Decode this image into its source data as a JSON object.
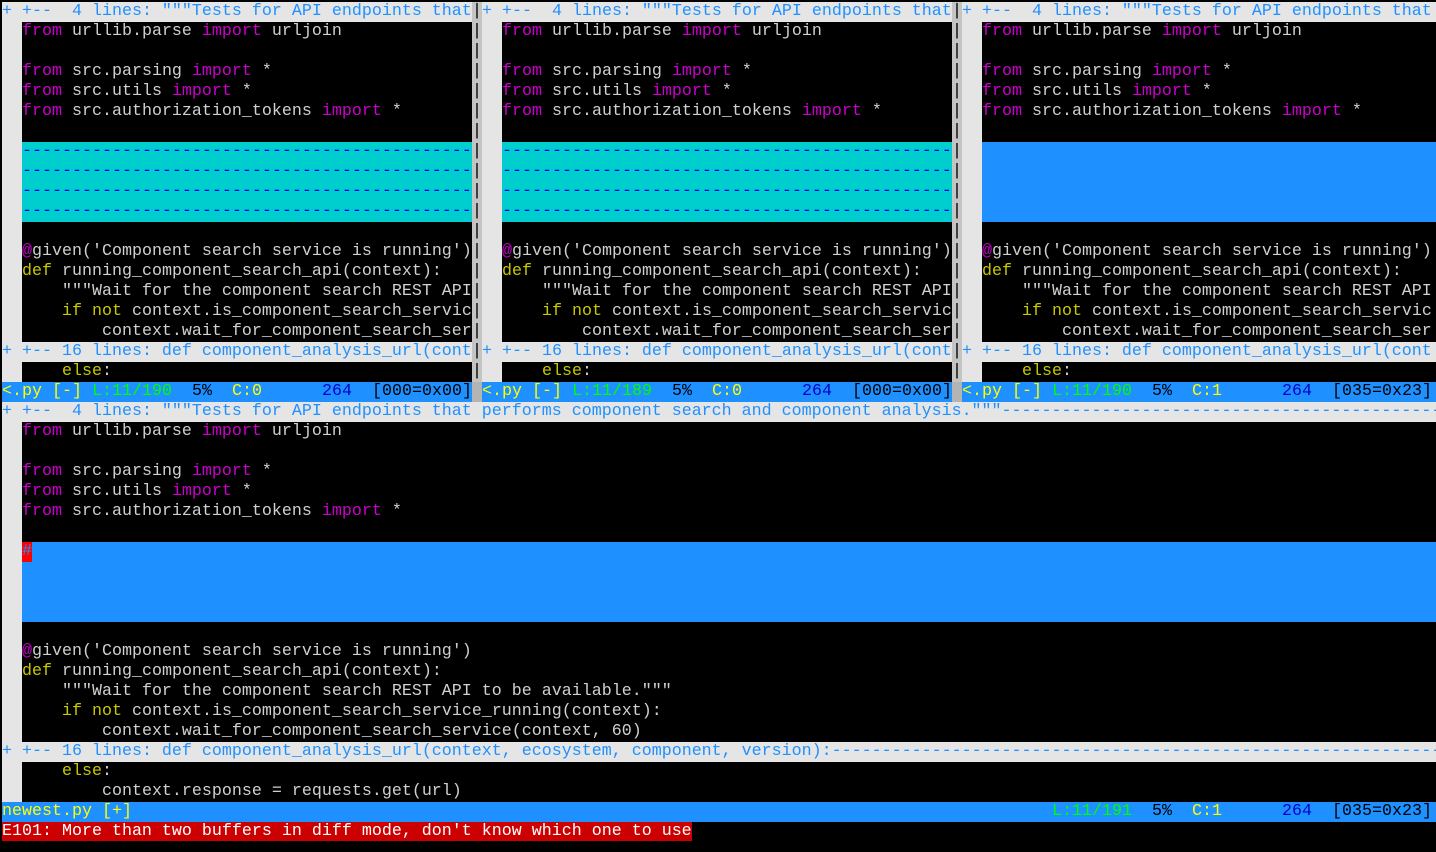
{
  "separator_char": "|",
  "top_lines": [
    {
      "type": "fold",
      "sign": "+",
      "text": "+--  4 lines: \"\"\"Tests for API endpoints that"
    },
    {
      "type": "code",
      "seg": [
        [
          "from",
          "kw"
        ],
        [
          " urllib.parse ",
          "n"
        ],
        [
          "import",
          "kw"
        ],
        [
          " urljoin",
          "n"
        ]
      ]
    },
    {
      "type": "code",
      "seg": []
    },
    {
      "type": "code",
      "seg": [
        [
          "from",
          "kw"
        ],
        [
          " src.parsing ",
          "n"
        ],
        [
          "import",
          "kw"
        ],
        [
          " *",
          "n"
        ]
      ]
    },
    {
      "type": "code",
      "seg": [
        [
          "from",
          "kw"
        ],
        [
          " src.utils ",
          "n"
        ],
        [
          "import",
          "kw"
        ],
        [
          " *",
          "n"
        ]
      ]
    },
    {
      "type": "code",
      "seg": [
        [
          "from",
          "kw"
        ],
        [
          " src.authorization_tokens ",
          "n"
        ],
        [
          "import",
          "kw"
        ],
        [
          " *",
          "n"
        ]
      ]
    },
    {
      "type": "code",
      "seg": []
    },
    {
      "type": "filler"
    },
    {
      "type": "filler"
    },
    {
      "type": "filler"
    },
    {
      "type": "filler"
    },
    {
      "type": "code",
      "seg": []
    },
    {
      "type": "code",
      "seg": [
        [
          "@",
          "at"
        ],
        [
          "given('Component search service is running')",
          "n"
        ]
      ]
    },
    {
      "type": "code",
      "seg": [
        [
          "def",
          "st"
        ],
        [
          " running_component_search_api(context):",
          "n"
        ]
      ]
    },
    {
      "type": "code",
      "seg": [
        [
          "    \"\"\"Wait for the component search REST API",
          "n"
        ]
      ]
    },
    {
      "type": "code",
      "seg": [
        [
          "    ",
          "n"
        ],
        [
          "if",
          "st"
        ],
        [
          " ",
          "n"
        ],
        [
          "not",
          "st"
        ],
        [
          " context.is_component_search_servic",
          "n"
        ]
      ]
    },
    {
      "type": "code",
      "seg": [
        [
          "        context.wait_for_component_search_ser",
          "n"
        ]
      ]
    },
    {
      "type": "fold",
      "sign": "+",
      "text": "+-- 16 lines: def component_analysis_url(cont"
    },
    {
      "type": "code",
      "seg": [
        [
          "    ",
          "n"
        ],
        [
          "else",
          "st"
        ],
        [
          ":",
          "n"
        ]
      ]
    }
  ],
  "bottom_lines": [
    {
      "type": "fold",
      "sign": "+",
      "text": "+--  4 lines: \"\"\"Tests for API endpoints that performs component search and component analysis.\"\"\""
    },
    {
      "type": "code",
      "seg": [
        [
          "from",
          "kw"
        ],
        [
          " urllib.parse ",
          "n"
        ],
        [
          "import",
          "kw"
        ],
        [
          " urljoin",
          "n"
        ]
      ]
    },
    {
      "type": "code",
      "seg": []
    },
    {
      "type": "code",
      "seg": [
        [
          "from",
          "kw"
        ],
        [
          " src.parsing ",
          "n"
        ],
        [
          "import",
          "kw"
        ],
        [
          " *",
          "n"
        ]
      ]
    },
    {
      "type": "code",
      "seg": [
        [
          "from",
          "kw"
        ],
        [
          " src.utils ",
          "n"
        ],
        [
          "import",
          "kw"
        ],
        [
          " *",
          "n"
        ]
      ]
    },
    {
      "type": "code",
      "seg": [
        [
          "from",
          "kw"
        ],
        [
          " src.authorization_tokens ",
          "n"
        ],
        [
          "import",
          "kw"
        ],
        [
          " *",
          "n"
        ]
      ]
    },
    {
      "type": "code",
      "seg": []
    },
    {
      "type": "filler",
      "marker": "#"
    },
    {
      "type": "filler"
    },
    {
      "type": "filler"
    },
    {
      "type": "filler"
    },
    {
      "type": "code",
      "seg": []
    },
    {
      "type": "code",
      "seg": [
        [
          "@",
          "at"
        ],
        [
          "given('Component search service is running')",
          "n"
        ]
      ]
    },
    {
      "type": "code",
      "seg": [
        [
          "def",
          "st"
        ],
        [
          " running_component_search_api(context):",
          "n"
        ]
      ]
    },
    {
      "type": "code",
      "seg": [
        [
          "    \"\"\"Wait for the component search REST API to be available.\"\"\"",
          "n"
        ]
      ]
    },
    {
      "type": "code",
      "seg": [
        [
          "    ",
          "n"
        ],
        [
          "if",
          "st"
        ],
        [
          " ",
          "n"
        ],
        [
          "not",
          "st"
        ],
        [
          " context.is_component_search_service_running(context):",
          "n"
        ]
      ]
    },
    {
      "type": "code",
      "seg": [
        [
          "        context.wait_for_component_search_service(context, 60)",
          "n"
        ]
      ]
    },
    {
      "type": "fold",
      "sign": "+",
      "text": "+-- 16 lines: def component_analysis_url(context, ecosystem, component, version):"
    },
    {
      "type": "code",
      "seg": [
        [
          "    ",
          "n"
        ],
        [
          "else",
          "st"
        ],
        [
          ":",
          "n"
        ]
      ]
    },
    {
      "type": "code",
      "seg": [
        [
          "        context.response = requests.get(url)",
          "n"
        ]
      ]
    }
  ],
  "panes": [
    {
      "filler_style": "cyan",
      "status": {
        "file": "<.py",
        "flag": "[-]",
        "line": "L:11/190",
        "pct": "5%",
        "col": "C:0",
        "num": "264",
        "char": "[000=0x00]"
      }
    },
    {
      "filler_style": "cyan",
      "status": {
        "file": "<.py",
        "flag": "[-]",
        "line": "L:11/189",
        "pct": "5%",
        "col": "C:0",
        "num": "264",
        "char": "[000=0x00]"
      }
    },
    {
      "filler_style": "blue",
      "status": {
        "file": "<.py",
        "flag": "[-]",
        "line": "L:11/190",
        "pct": "5%",
        "col": "C:1",
        "num": "264",
        "char": "[035=0x23]"
      }
    }
  ],
  "bottom_status": {
    "file": "newest.py",
    "flag": "[+]",
    "line": "L:11/191",
    "pct": "5%",
    "col": "C:1",
    "num": "264",
    "char": "[035=0x23]"
  },
  "error_message": "E101: More than two buffers in diff mode, don't know which one to use"
}
